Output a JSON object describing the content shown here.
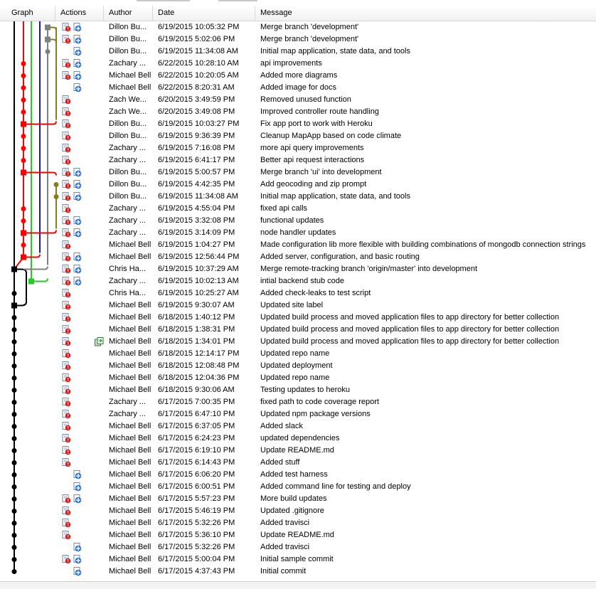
{
  "columns": {
    "graph": "Graph",
    "actions": "Actions",
    "author": "Author",
    "date": "Date",
    "message": "Message"
  },
  "icons": {
    "warning": "commit-warning-icon",
    "push": "push-icon",
    "compare": "compare-icon"
  },
  "colors": {
    "black": "#000000",
    "red": "#ff0000",
    "green": "#22cc22",
    "blue": "#1a1aa8",
    "olive": "#7f7f1f",
    "gray": "#808080"
  },
  "rows": [
    {
      "author": "Dillon Bu...",
      "date": "6/19/2015 10:05:32 PM",
      "message": "Merge branch 'development'",
      "warn": true,
      "push": true
    },
    {
      "author": "Dillon Bu...",
      "date": "6/19/2015 5:02:06 PM",
      "message": "Merge branch 'development'",
      "warn": true,
      "push": true
    },
    {
      "author": "Dillon Bu...",
      "date": "6/19/2015 11:34:08 AM",
      "message": "Initial map application, state data, and tools",
      "warn": false,
      "push": true
    },
    {
      "author": "Zachary ...",
      "date": "6/22/2015 10:28:10 AM",
      "message": "api improvements",
      "warn": true,
      "push": true
    },
    {
      "author": "Michael Bell",
      "date": "6/22/2015 10:20:05 AM",
      "message": "Added more diagrams",
      "warn": true,
      "push": true
    },
    {
      "author": "Michael Bell",
      "date": "6/22/2015 8:20:31 AM",
      "message": "Added image for docs",
      "warn": false,
      "push": true
    },
    {
      "author": "Zach We...",
      "date": "6/20/2015 3:49:59 PM",
      "message": "Removed unused function",
      "warn": true,
      "push": false
    },
    {
      "author": "Zach We...",
      "date": "6/20/2015 3:49:08 PM",
      "message": "Improved controller route handling",
      "warn": true,
      "push": false
    },
    {
      "author": "Dillon Bu...",
      "date": "6/19/2015 10:03:27 PM",
      "message": "Fix app port to work with Heroku",
      "warn": true,
      "push": false
    },
    {
      "author": "Dillon Bu...",
      "date": "6/19/2015 9:36:39 PM",
      "message": "Cleanup MapApp based on code climate",
      "warn": true,
      "push": false
    },
    {
      "author": "Zachary ...",
      "date": "6/19/2015 7:16:08 PM",
      "message": "more api query improvements",
      "warn": true,
      "push": false
    },
    {
      "author": "Zachary ...",
      "date": "6/19/2015 6:41:17 PM",
      "message": "Better api request interactions",
      "warn": true,
      "push": false
    },
    {
      "author": "Dillon Bu...",
      "date": "6/19/2015 5:00:57 PM",
      "message": "Merge branch 'ui' into development",
      "warn": true,
      "push": true
    },
    {
      "author": "Dillon Bu...",
      "date": "6/19/2015 4:42:35 PM",
      "message": "Add geocoding and zip prompt",
      "warn": true,
      "push": true
    },
    {
      "author": "Dillon Bu...",
      "date": "6/19/2015 11:34:08 AM",
      "message": "Initial map application, state data, and tools",
      "warn": true,
      "push": true
    },
    {
      "author": "Zachary ...",
      "date": "6/19/2015 4:55:04 PM",
      "message": "fixed api calls",
      "warn": true,
      "push": false
    },
    {
      "author": "Zachary ...",
      "date": "6/19/2015 3:32:08 PM",
      "message": "functional updates",
      "warn": true,
      "push": true
    },
    {
      "author": "Zachary ...",
      "date": "6/19/2015 3:14:09 PM",
      "message": "node handler updates",
      "warn": true,
      "push": true
    },
    {
      "author": "Michael Bell",
      "date": "6/19/2015 1:04:27 PM",
      "message": "Made configuration lib more flexible with building combinations of mongodb connection strings",
      "warn": true,
      "push": false
    },
    {
      "author": "Michael Bell",
      "date": "6/19/2015 12:56:44 PM",
      "message": "Added server, configuration, and basic routing",
      "warn": true,
      "push": true
    },
    {
      "author": "Chris Ha...",
      "date": "6/19/2015 10:37:29 AM",
      "message": "Merge remote-tracking branch 'origin/master' into development",
      "warn": true,
      "push": true
    },
    {
      "author": "Zachary ...",
      "date": "6/19/2015 10:02:13 AM",
      "message": "intial backend stub code",
      "warn": true,
      "push": true
    },
    {
      "author": "Chris Ha...",
      "date": "6/19/2015 10:25:27 AM",
      "message": "Added check-leaks to test script",
      "warn": true,
      "push": false
    },
    {
      "author": "Michael Bell",
      "date": "6/19/2015 9:30:07 AM",
      "message": "Updated site label",
      "warn": true,
      "push": false
    },
    {
      "author": "Michael Bell",
      "date": "6/18/2015 1:40:12 PM",
      "message": "Updated build process and moved application files to app directory for better collection",
      "warn": true,
      "push": false
    },
    {
      "author": "Michael Bell",
      "date": "6/18/2015 1:38:31 PM",
      "message": "Updated build process and moved application files to app directory for better collection",
      "warn": true,
      "push": false
    },
    {
      "author": "Michael Bell",
      "date": "6/18/2015 1:34:01 PM",
      "message": "Updated build process and moved application files to app directory for better collection",
      "warn": true,
      "push": false,
      "compare": true
    },
    {
      "author": "Michael Bell",
      "date": "6/18/2015 12:14:17 PM",
      "message": "Updated repo name",
      "warn": true,
      "push": false
    },
    {
      "author": "Michael Bell",
      "date": "6/18/2015 12:08:48 PM",
      "message": "Updated deployment",
      "warn": true,
      "push": false
    },
    {
      "author": "Michael Bell",
      "date": "6/18/2015 12:04:36 PM",
      "message": "Updated repo name",
      "warn": true,
      "push": false
    },
    {
      "author": "Michael Bell",
      "date": "6/18/2015 9:30:06 AM",
      "message": "Testing updates to heroku",
      "warn": true,
      "push": false
    },
    {
      "author": "Zachary ...",
      "date": "6/17/2015 7:00:35 PM",
      "message": "fixed path to code coverage report",
      "warn": true,
      "push": false
    },
    {
      "author": "Zachary ...",
      "date": "6/17/2015 6:47:10 PM",
      "message": "Updated npm package versions",
      "warn": true,
      "push": false
    },
    {
      "author": "Michael Bell",
      "date": "6/17/2015 6:37:05 PM",
      "message": "Added slack",
      "warn": true,
      "push": false
    },
    {
      "author": "Michael Bell",
      "date": "6/17/2015 6:24:23 PM",
      "message": "updated dependencies",
      "warn": true,
      "push": false
    },
    {
      "author": "Michael Bell",
      "date": "6/17/2015 6:19:10 PM",
      "message": "Update README.md",
      "warn": true,
      "push": false
    },
    {
      "author": "Michael Bell",
      "date": "6/17/2015 6:14:43 PM",
      "message": "Added stuff",
      "warn": true,
      "push": false
    },
    {
      "author": "Michael Bell",
      "date": "6/17/2015 6:06:20 PM",
      "message": "Added test harness",
      "warn": false,
      "push": true
    },
    {
      "author": "Michael Bell",
      "date": "6/17/2015 6:00:51 PM",
      "message": "Added command line for testing and deploy",
      "warn": false,
      "push": true
    },
    {
      "author": "Michael Bell",
      "date": "6/17/2015 5:57:23 PM",
      "message": "More build updates",
      "warn": true,
      "push": true
    },
    {
      "author": "Michael Bell",
      "date": "6/17/2015 5:46:19 PM",
      "message": "Updated .gitignore",
      "warn": true,
      "push": false
    },
    {
      "author": "Michael Bell",
      "date": "6/17/2015 5:32:26 PM",
      "message": "Added travisci",
      "warn": true,
      "push": false
    },
    {
      "author": "Michael Bell",
      "date": "6/17/2015 5:36:10 PM",
      "message": "Update README.md",
      "warn": true,
      "push": false
    },
    {
      "author": "Michael Bell",
      "date": "6/17/2015 5:32:26 PM",
      "message": "Added travisci",
      "warn": false,
      "push": true
    },
    {
      "author": "Michael Bell",
      "date": "6/17/2015 5:00:04 PM",
      "message": "Initial sample commit",
      "warn": true,
      "push": true
    },
    {
      "author": "Michael Bell",
      "date": "6/17/2015 4:37:43 PM",
      "message": "Initial commit",
      "warn": false,
      "push": true
    }
  ]
}
